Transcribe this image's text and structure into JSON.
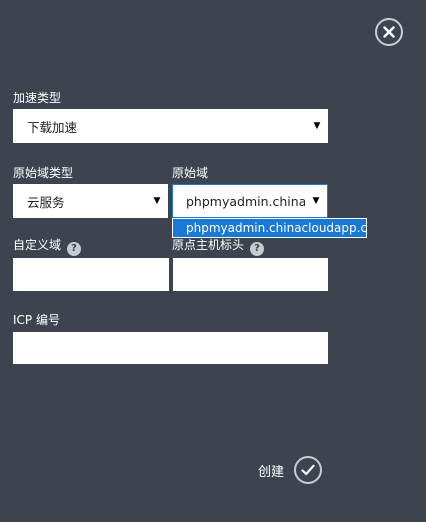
{
  "form": {
    "accel_type_label": "加速类型",
    "accel_type_value": "下载加速",
    "origin_type_label": "原始域类型",
    "origin_type_value": "云服务",
    "origin_domain_label": "原始域",
    "origin_domain_value": "phpmyadmin.chinac",
    "origin_domain_option": "phpmyadmin.chinacloudapp.cn",
    "custom_domain_label": "自定义域",
    "custom_domain_value": "",
    "origin_host_header_label": "原点主机标头",
    "origin_host_header_value": "",
    "icp_label": "ICP 编号",
    "icp_value": "",
    "help_glyph": "?",
    "create_label": "创建"
  },
  "icons": {
    "close": "close-icon",
    "confirm": "checkmark-icon",
    "help": "question-icon",
    "caret": "caret-down-icon"
  },
  "colors": {
    "background": "#3d4450",
    "selected_option": "#1b79d6"
  }
}
